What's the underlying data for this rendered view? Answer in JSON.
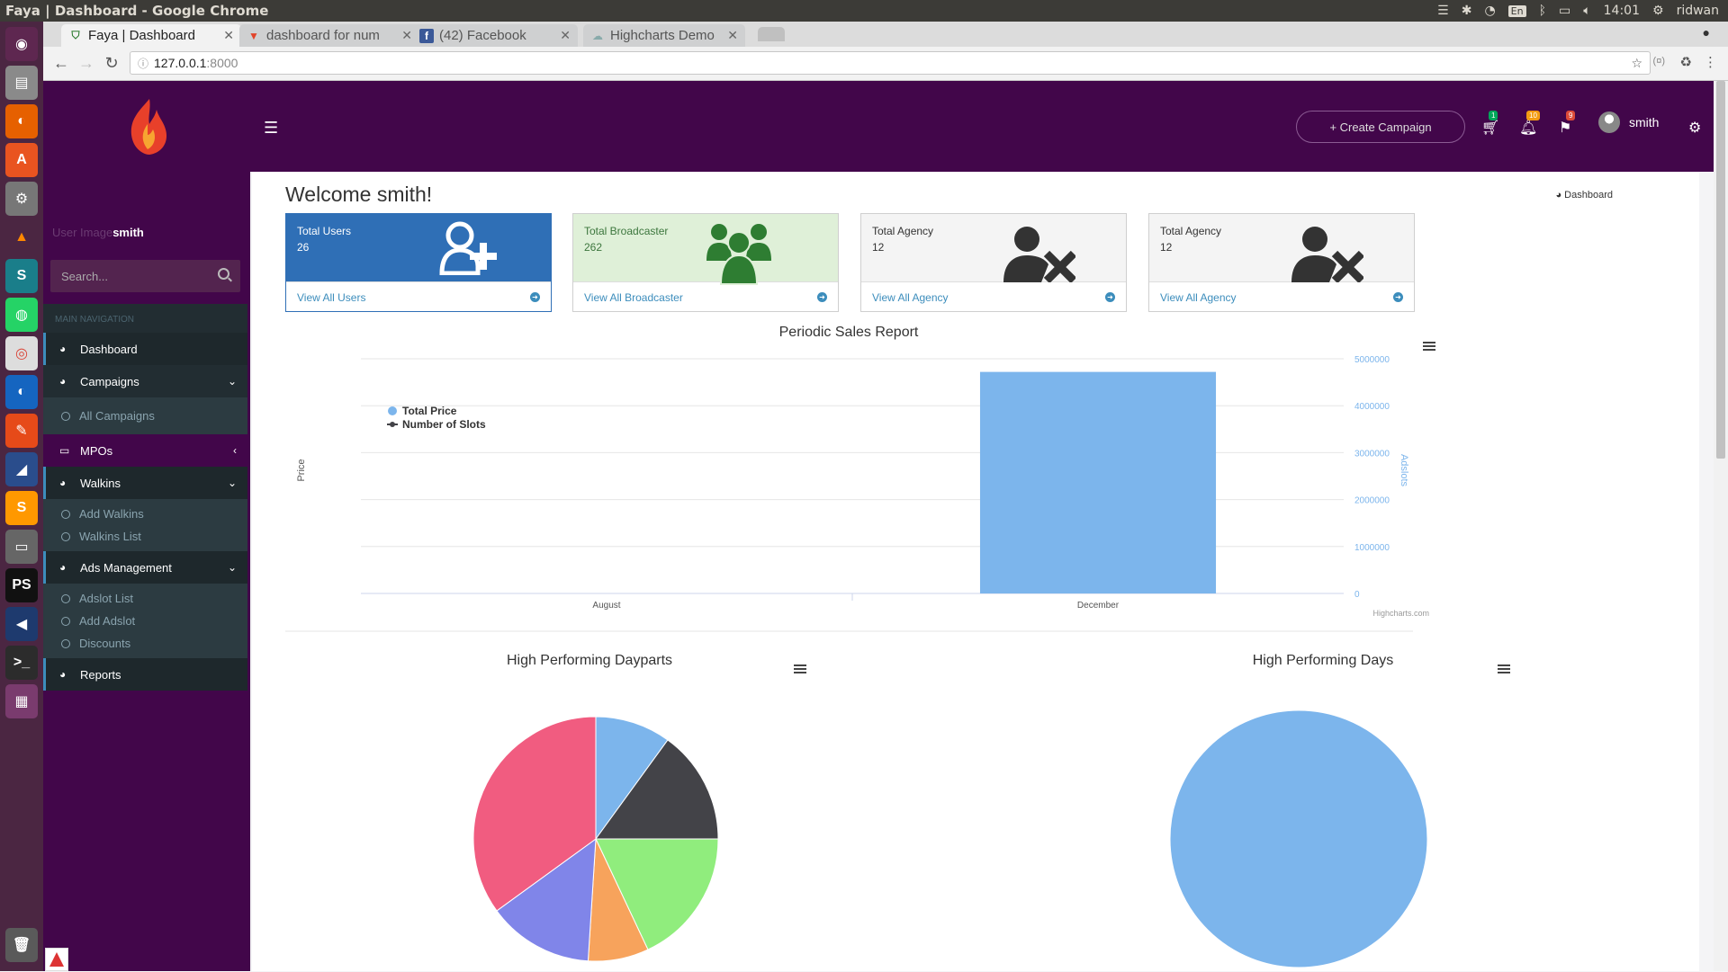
{
  "system_bar": {
    "window_title": "Faya | Dashboard - Google Chrome",
    "input_lang": "En",
    "clock": "14:01",
    "user": "ridwan"
  },
  "browser": {
    "tabs": [
      {
        "label": "Faya | Dashboard",
        "icon": "shield-icon",
        "active": true
      },
      {
        "label": "dashboard for num",
        "icon": "gitlab-icon",
        "active": false
      },
      {
        "label": "(42) Facebook",
        "icon": "facebook-icon",
        "active": false
      },
      {
        "label": "Highcharts Demo",
        "icon": "cloud-icon",
        "active": false
      }
    ],
    "url_host": "127.0.0.1",
    "url_port": ":8000"
  },
  "header": {
    "create_button": "+ Create Campaign",
    "cart_badge": "1",
    "bell_badge": "10",
    "flag_badge": "9",
    "username": "smith"
  },
  "sidebar": {
    "user_image_alt": "User Image",
    "username": "smith",
    "search_placeholder": "Search...",
    "nav_header": "MAIN NAVIGATION",
    "items": {
      "dashboard": "Dashboard",
      "campaigns": "Campaigns",
      "all_campaigns": "All Campaigns",
      "mpos": "MPOs",
      "walkins": "Walkins",
      "add_walkins": "Add Walkins",
      "walkins_list": "Walkins List",
      "ads_management": "Ads Management",
      "adslot_list": "Adslot List",
      "add_adslot": "Add Adslot",
      "discounts": "Discounts",
      "reports": "Reports"
    }
  },
  "content": {
    "welcome": "Welcome smith!",
    "breadcrumb": "Dashboard",
    "cards": [
      {
        "title": "Total Users",
        "value": "26",
        "link": "View All Users",
        "bg": "#2f6fb6",
        "color": "#ffffff"
      },
      {
        "title": "Total Broadcaster",
        "value": "262",
        "link": "View All Broadcaster",
        "bg": "#dff0d8",
        "color": "#3c763d"
      },
      {
        "title": "Total Agency",
        "value": "12",
        "link": "View All Agency",
        "bg": "#f4f4f4",
        "color": "#333333"
      },
      {
        "title": "Total Agency",
        "value": "12",
        "link": "View All Agency",
        "bg": "#f4f4f4",
        "color": "#333333"
      }
    ]
  },
  "chart_data": [
    {
      "type": "bar",
      "title": "Periodic Sales Report",
      "categories": [
        "August",
        "December"
      ],
      "series": [
        {
          "name": "Total Price",
          "values": [
            0,
            4720000
          ],
          "color": "#7cb5ec"
        },
        {
          "name": "Number of Slots",
          "values": [
            0,
            0
          ],
          "color": "#434348"
        }
      ],
      "ylabel_left": "Price",
      "ylabel_right": "Adslots",
      "ylim": [
        0,
        5000000
      ],
      "yticks": [
        "0",
        "1000000",
        "2000000",
        "3000000",
        "4000000",
        "5000000"
      ],
      "credits": "Highcharts.com",
      "legend": "top-left"
    },
    {
      "type": "pie",
      "title": "High Performing Dayparts",
      "slices": [
        {
          "value": 10,
          "color": "#7cb5ec"
        },
        {
          "value": 15,
          "color": "#434348"
        },
        {
          "value": 18,
          "color": "#90ed7d"
        },
        {
          "value": 8,
          "color": "#f7a35c"
        },
        {
          "value": 14,
          "color": "#8085e9"
        },
        {
          "value": 35,
          "color": "#f15c80"
        }
      ]
    },
    {
      "type": "pie",
      "title": "High Performing Days",
      "slices": [
        {
          "value": 100,
          "color": "#7cb5ec"
        }
      ]
    }
  ]
}
